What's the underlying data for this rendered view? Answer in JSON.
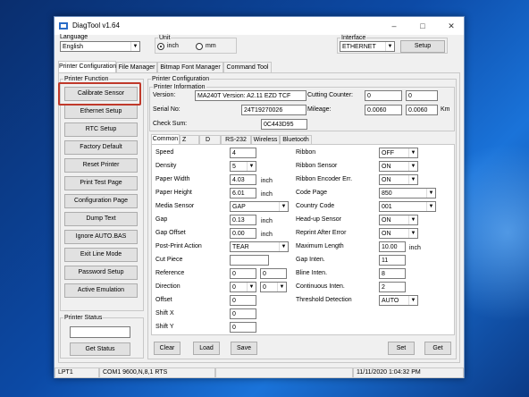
{
  "window": {
    "title": "DiagTool v1.64"
  },
  "language": {
    "label": "Language",
    "value": "English"
  },
  "unit": {
    "label": "Unit",
    "inch": "inch",
    "mm": "mm",
    "selected": "inch"
  },
  "interface": {
    "label": "Interface",
    "value": "ETHERNET",
    "setup": "Setup"
  },
  "main_tabs": [
    "Printer Configuration",
    "File Manager",
    "Bitmap Font Manager",
    "Command Tool"
  ],
  "printer_function": {
    "title": "Printer Function",
    "buttons": [
      "Calibrate Sensor",
      "Ethernet Setup",
      "RTC Setup",
      "Factory Default",
      "Reset Printer",
      "Print Test Page",
      "Configuration Page",
      "Dump Text",
      "Ignore AUTO.BAS",
      "Exit Line Mode",
      "Password Setup",
      "Active Emulation"
    ]
  },
  "printer_status": {
    "title": "Printer Status",
    "value": "",
    "button": "Get Status"
  },
  "printer_config": {
    "title": "Printer Configuration",
    "info_title": "Printer Information",
    "version_label": "Version:",
    "version": "MA240T Version: A2.11 EZD TCF",
    "serial_label": "Serial No:",
    "serial": "24T19270026",
    "checksum_label": "Check Sum:",
    "checksum": "0C443D95",
    "cutting_label": "Cutting Counter:",
    "cutting_1": "0",
    "cutting_2": "0",
    "mileage_label": "Mileage:",
    "mileage_1": "0.0060",
    "mileage_2": "0.0060",
    "mileage_unit": "Km"
  },
  "sub_tabs": [
    "Common",
    "Z",
    "D",
    "RS-232",
    "Wireless",
    "Bluetooth"
  ],
  "common": {
    "left": [
      {
        "label": "Speed",
        "value": "4"
      },
      {
        "label": "Density",
        "value": "5"
      },
      {
        "label": "Paper Width",
        "value": "4.03",
        "unit": "inch"
      },
      {
        "label": "Paper Height",
        "value": "6.01",
        "unit": "inch"
      },
      {
        "label": "Media Sensor",
        "value": "GAP"
      },
      {
        "label": "Gap",
        "value": "0.13",
        "unit": "inch"
      },
      {
        "label": "Gap Offset",
        "value": "0.00",
        "unit": "inch"
      },
      {
        "label": "Post-Print Action",
        "value": "TEAR"
      },
      {
        "label": "Cut Piece",
        "value": ""
      },
      {
        "label": "Reference",
        "value": "0",
        "value2": "0"
      },
      {
        "label": "Direction",
        "value": "0",
        "value2": "0"
      },
      {
        "label": "Offset",
        "value": "0"
      },
      {
        "label": "Shift X",
        "value": "0"
      },
      {
        "label": "Shift Y",
        "value": "0"
      }
    ],
    "right": [
      {
        "label": "Ribbon",
        "value": "OFF"
      },
      {
        "label": "Ribbon Sensor",
        "value": "ON"
      },
      {
        "label": "Ribbon Encoder Err.",
        "value": "ON"
      },
      {
        "label": "Code Page",
        "value": "850"
      },
      {
        "label": "Country Code",
        "value": "001"
      },
      {
        "label": "Head-up Sensor",
        "value": "ON"
      },
      {
        "label": "Reprint After Error",
        "value": "ON"
      },
      {
        "label": "Maximum Length",
        "value": "10.00",
        "unit": "inch"
      },
      {
        "label": "Gap Inten.",
        "value": "11"
      },
      {
        "label": "Bline Inten.",
        "value": "8"
      },
      {
        "label": "Continuous Inten.",
        "value": "2"
      },
      {
        "label": "Threshold Detection",
        "value": "AUTO"
      }
    ],
    "buttons": {
      "clear": "Clear",
      "load": "Load",
      "save": "Save",
      "set": "Set",
      "get": "Get"
    }
  },
  "status_bar": {
    "port": "LPT1",
    "com": "COM1 9600,N,8,1 RTS",
    "blank": "",
    "datetime": "11/11/2020 1:04:32 PM"
  },
  "colors": {
    "highlight": "#c0392b",
    "desktop": "#0c4aa6"
  }
}
